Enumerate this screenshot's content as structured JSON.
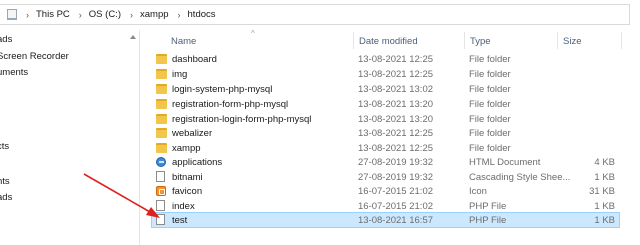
{
  "address": {
    "crumbs": [
      "This PC",
      "OS (C:)",
      "xampp",
      "htdocs"
    ]
  },
  "nav": {
    "items": [
      "ads",
      "Screen Recorder",
      "uments",
      "cts",
      "nts",
      "ads"
    ]
  },
  "columns": {
    "name": "Name",
    "date": "Date modified",
    "type": "Type",
    "size": "Size"
  },
  "files": [
    {
      "name": "dashboard",
      "date": "13-08-2021 12:25",
      "type": "File folder",
      "size": "",
      "icon": "folder-icon"
    },
    {
      "name": "img",
      "date": "13-08-2021 12:25",
      "type": "File folder",
      "size": "",
      "icon": "folder-icon"
    },
    {
      "name": "login-system-php-mysql",
      "date": "13-08-2021 13:02",
      "type": "File folder",
      "size": "",
      "icon": "folder-icon"
    },
    {
      "name": "registration-form-php-mysql",
      "date": "13-08-2021 13:20",
      "type": "File folder",
      "size": "",
      "icon": "folder-icon"
    },
    {
      "name": "registration-login-form-php-mysql",
      "date": "13-08-2021 13:20",
      "type": "File folder",
      "size": "",
      "icon": "folder-icon"
    },
    {
      "name": "webalizer",
      "date": "13-08-2021 12:25",
      "type": "File folder",
      "size": "",
      "icon": "folder-icon"
    },
    {
      "name": "xampp",
      "date": "13-08-2021 12:25",
      "type": "File folder",
      "size": "",
      "icon": "folder-icon"
    },
    {
      "name": "applications",
      "date": "27-08-2019 19:32",
      "type": "HTML Document",
      "size": "4 KB",
      "icon": "html-document-icon"
    },
    {
      "name": "bitnami",
      "date": "27-08-2019 19:32",
      "type": "Cascading Style Shee...",
      "size": "1 KB",
      "icon": "document-icon"
    },
    {
      "name": "favicon",
      "date": "16-07-2015 21:02",
      "type": "Icon",
      "size": "31 KB",
      "icon": "icon-file-icon"
    },
    {
      "name": "index",
      "date": "16-07-2015 21:02",
      "type": "PHP File",
      "size": "1 KB",
      "icon": "document-icon"
    },
    {
      "name": "test",
      "date": "13-08-2021 16:57",
      "type": "PHP File",
      "size": "1 KB",
      "icon": "document-icon"
    }
  ],
  "selection": {
    "selected_file": "test"
  },
  "colors": {
    "selection_bg": "#cce8ff",
    "annotation_arrow": "#e02020"
  }
}
